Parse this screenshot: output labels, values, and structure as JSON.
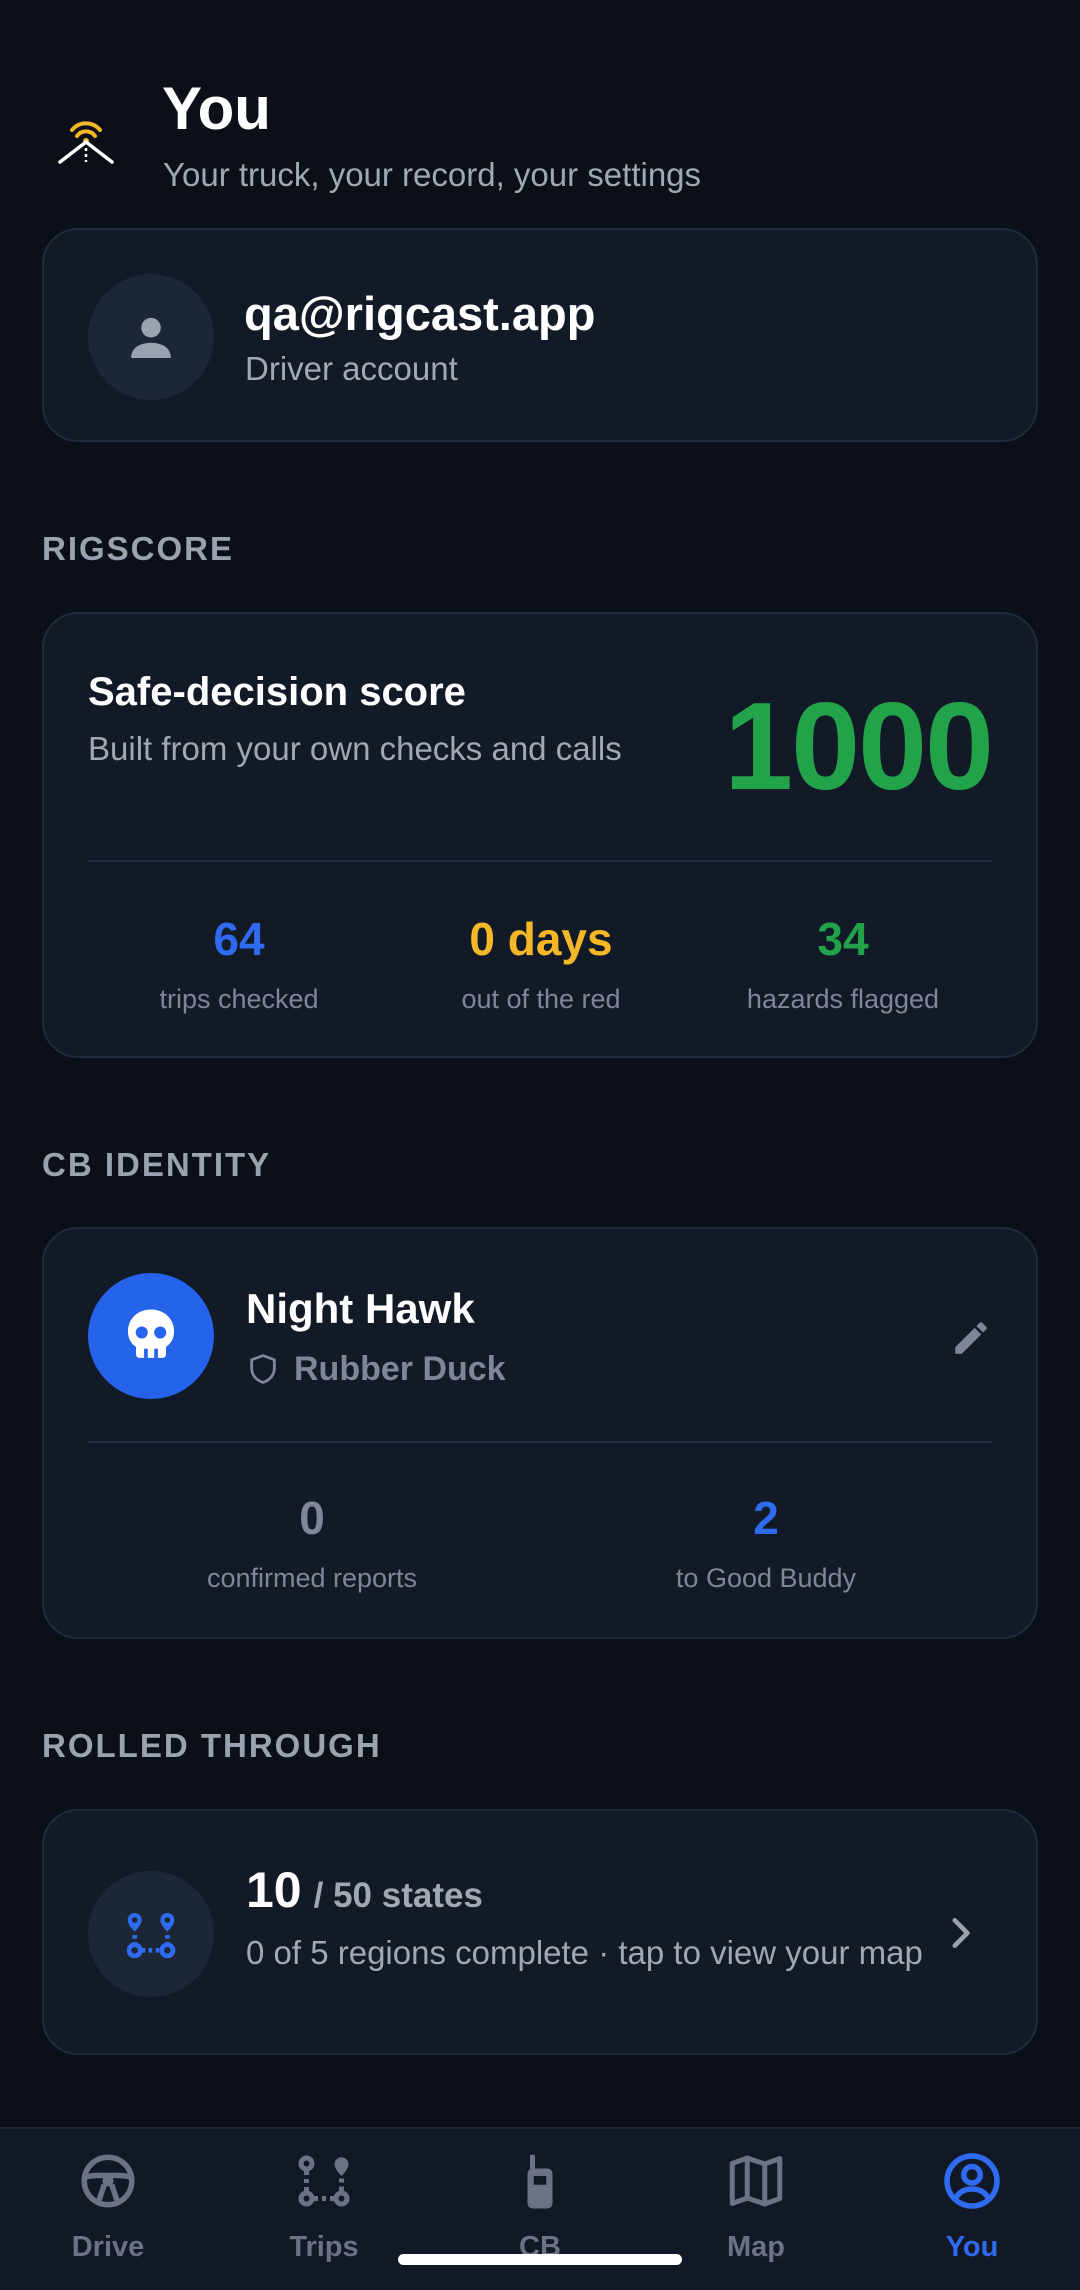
{
  "header": {
    "title": "You",
    "subtitle": "Your truck, your record, your settings",
    "logo_icon": "signal-road-icon"
  },
  "account": {
    "email": "qa@rigcast.app",
    "role": "Driver account",
    "avatar_icon": "person-icon"
  },
  "sections": {
    "rigscore": "RIGSCORE",
    "cb_identity": "CB IDENTITY",
    "rolled_through": "ROLLED THROUGH"
  },
  "rigscore": {
    "title": "Safe-decision score",
    "description": "Built from your own checks and calls",
    "value": "1000",
    "stats": [
      {
        "value": "64",
        "label": "trips checked",
        "color": "#2f6bf0"
      },
      {
        "value": "0 days",
        "label": "out of the red",
        "color": "#f4b728"
      },
      {
        "value": "34",
        "label": "hazards flagged",
        "color": "#22a34a"
      }
    ]
  },
  "cb_identity": {
    "handle": "Night Hawk",
    "rank": "Rubber Duck",
    "avatar_icon": "skull-icon",
    "stats": [
      {
        "value": "0",
        "label": "confirmed reports",
        "color": "#7f8797"
      },
      {
        "value": "2",
        "label": "to Good Buddy",
        "color": "#2f6bf0"
      }
    ]
  },
  "rolled_through": {
    "count": "10",
    "total": "/ 50 states",
    "regions": "0 of 5 regions complete · tap to view your map"
  },
  "nav": [
    {
      "label": "Drive",
      "icon": "steering-wheel-icon",
      "active": false
    },
    {
      "label": "Trips",
      "icon": "route-icon",
      "active": false
    },
    {
      "label": "CB",
      "icon": "walkie-talkie-icon",
      "active": false
    },
    {
      "label": "Map",
      "icon": "map-icon",
      "active": false
    },
    {
      "label": "You",
      "icon": "account-circle-icon",
      "active": true
    }
  ],
  "colors": {
    "background": "#0b0f17",
    "card": "#131a27",
    "accent_blue": "#2f6bf0",
    "score_green": "#22a34a",
    "warning_yellow": "#f4b728"
  }
}
